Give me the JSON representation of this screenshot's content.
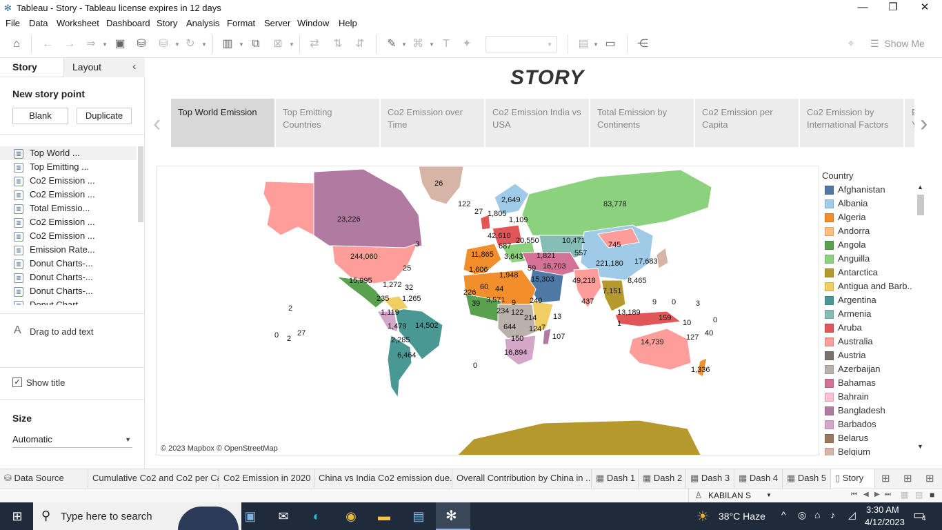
{
  "window": {
    "title": "Tableau - Story - Tableau license expires in 12 days",
    "icons": {
      "app": "tableau-snowflake-icon",
      "min": "minimize-icon",
      "max": "restore-icon",
      "close": "close-icon"
    }
  },
  "menu": [
    "File",
    "Data",
    "Worksheet",
    "Dashboard",
    "Story",
    "Analysis",
    "Format",
    "Server",
    "Window",
    "Help"
  ],
  "toolbar": {
    "show_me": "Show Me"
  },
  "left_pane": {
    "tab_story": "Story",
    "tab_layout": "Layout",
    "new_story_point": "New story point",
    "blank_btn": "Blank",
    "duplicate_btn": "Duplicate",
    "story_points": [
      "Top World ...",
      "Top Emitting ...",
      "Co2 Emission ...",
      "Co2 Emission ...",
      "Total Emissio...",
      "Co2 Emission ...",
      "Co2 Emission ...",
      "Emission Rate...",
      "Donut Charts-...",
      "Donut Charts-...",
      "Donut Charts-...",
      "Donut Chart..."
    ],
    "drag_text": "Drag to add text",
    "show_title": "Show title",
    "size_label": "Size",
    "size_value": "Automatic"
  },
  "story": {
    "title": "STORY",
    "points": [
      "Top World Emission",
      "Top Emitting Countries",
      "Co2 Emission over Time",
      "Co2 Emission India vs USA",
      "Total Emission by Continents",
      "Co2 Emission per Capita",
      "Co2 Emission by International Factors",
      "E Y"
    ],
    "active_index": 0
  },
  "map": {
    "attribution": "© 2023 Mapbox © OpenStreetMap",
    "labels": [
      "26",
      "122",
      "2,649",
      "27",
      "1,805",
      "1,109",
      "83,778",
      "23,226",
      "42,610",
      "687",
      "20,550",
      "10,471",
      "745",
      "3",
      "244,060",
      "557",
      "221,180",
      "11,865",
      "3,643",
      "1,821",
      "16,703",
      "17,683",
      "25",
      "1,606",
      "59",
      "1,948",
      "15,303",
      "49,218",
      "8,465",
      "15,995",
      "1,272",
      "32",
      "60",
      "44",
      "7,151",
      "226",
      "1,265",
      "3,571",
      "9",
      "240",
      "437",
      "9",
      "0",
      "3",
      "39",
      "235",
      "234",
      "122",
      "13,189",
      "1,119",
      "214",
      "159",
      "2",
      "124",
      "7",
      "13",
      "0",
      "1",
      "1,479",
      "14,502",
      "644",
      "10",
      "127",
      "40",
      "2",
      "0",
      "27",
      "150",
      "107",
      "14,739",
      "2,285",
      "16,894",
      "6,464",
      "0",
      "1,336"
    ]
  },
  "legend": {
    "title": "Country",
    "items": [
      {
        "name": "Afghanistan",
        "color": "#4e79a7"
      },
      {
        "name": "Albania",
        "color": "#a0cbe8"
      },
      {
        "name": "Algeria",
        "color": "#f28e2b"
      },
      {
        "name": "Andorra",
        "color": "#ffbe7d"
      },
      {
        "name": "Angola",
        "color": "#59a14f"
      },
      {
        "name": "Anguilla",
        "color": "#8cd17d"
      },
      {
        "name": "Antarctica",
        "color": "#b6992d"
      },
      {
        "name": "Antigua and Barb..",
        "color": "#f1ce63"
      },
      {
        "name": "Argentina",
        "color": "#499894"
      },
      {
        "name": "Armenia",
        "color": "#86bcb6"
      },
      {
        "name": "Aruba",
        "color": "#e15759"
      },
      {
        "name": "Australia",
        "color": "#ff9d9a"
      },
      {
        "name": "Austria",
        "color": "#79706e"
      },
      {
        "name": "Azerbaijan",
        "color": "#bab0ac"
      },
      {
        "name": "Bahamas",
        "color": "#d37295"
      },
      {
        "name": "Bahrain",
        "color": "#fabfd2"
      },
      {
        "name": "Bangladesh",
        "color": "#b07aa1"
      },
      {
        "name": "Barbados",
        "color": "#d4a6c8"
      },
      {
        "name": "Belarus",
        "color": "#9d7660"
      },
      {
        "name": "Belgium",
        "color": "#d7b5a6"
      }
    ]
  },
  "sheet_tabs": [
    "Data Source",
    "Cumulative Co2 and Co2 per Ca...",
    "Co2 Emission in 2020",
    "China vs India Co2 emission due...",
    "Overall Contribution by China in ...",
    "Dash 1",
    "Dash 2",
    "Dash 3",
    "Dash 4",
    "Dash 5",
    "Story"
  ],
  "status": {
    "user": "KABILAN S"
  },
  "taskbar": {
    "search_placeholder": "Type here to search",
    "weather": "38°C  Haze",
    "time": "3:30 AM",
    "date": "4/12/2023",
    "notifications": "4"
  }
}
